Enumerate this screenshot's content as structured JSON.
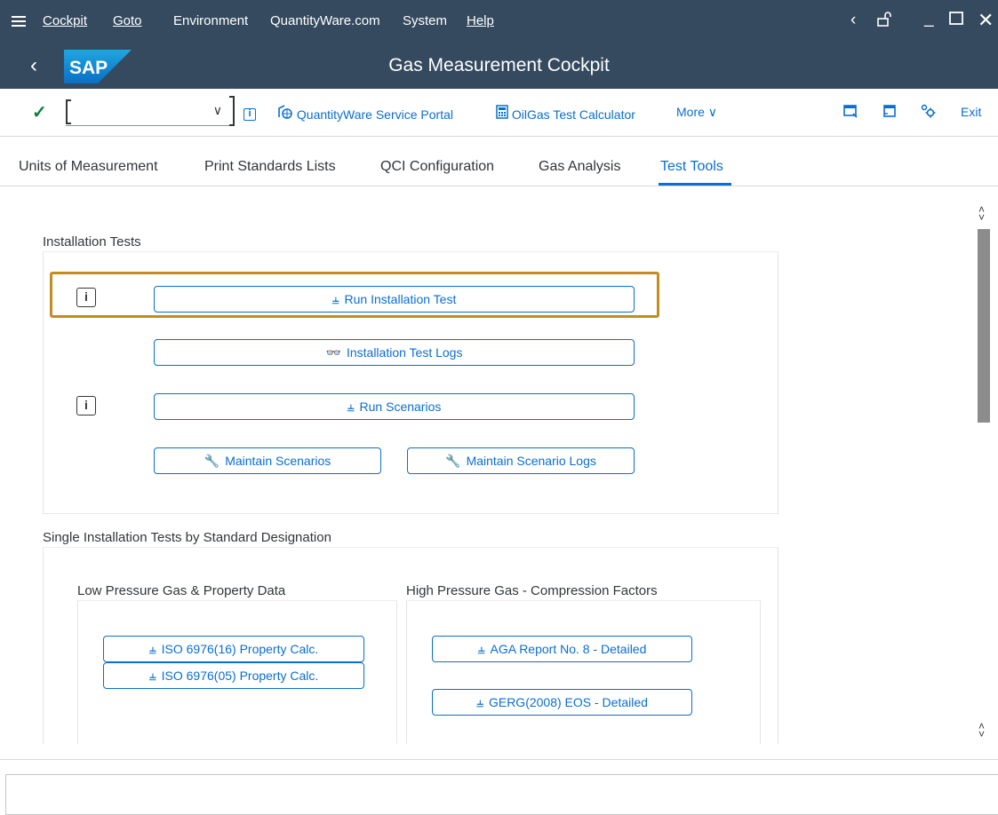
{
  "menubar": {
    "items": [
      "Cockpit",
      "Goto",
      "Environment",
      "QuantityWare.com",
      "System",
      "Help"
    ],
    "window_controls": {
      "back": "<",
      "lock": "lock-icon",
      "minimize": "_",
      "maximize": "□",
      "close": "×"
    }
  },
  "titlebar": {
    "logo": "SAP",
    "title": "Gas Measurement Cockpit"
  },
  "toolbar": {
    "command_field_value": "",
    "portal_label": "QuantityWare Service Portal",
    "calculator_label": "OilGas Test Calculator",
    "more_label": "More",
    "exit_label": "Exit",
    "colors": {
      "accent": "#0a6ed1",
      "check": "#107e3e",
      "shell": "#354a5f",
      "highlight": "#c28d1d"
    }
  },
  "tabs": [
    {
      "label": "Units of Measurement",
      "active": false
    },
    {
      "label": "Print Standards Lists",
      "active": false
    },
    {
      "label": "QCI Configuration",
      "active": false
    },
    {
      "label": "Gas Analysis",
      "active": false
    },
    {
      "label": "Test Tools",
      "active": true
    }
  ],
  "installation_tests": {
    "title": "Installation Tests",
    "run_installation_test": "Run Installation Test",
    "installation_test_logs": "Installation Test Logs",
    "run_scenarios": "Run Scenarios",
    "maintain_scenarios": "Maintain Scenarios",
    "maintain_scenario_logs": "Maintain Scenario Logs"
  },
  "single_tests": {
    "title": "Single Installation Tests by Standard Designation",
    "low_pressure": {
      "title": "Low Pressure Gas & Property Data",
      "buttons": [
        "ISO 6976(16) Property Calc.",
        "ISO 6976(05) Property Calc."
      ]
    },
    "high_pressure": {
      "title": "High Pressure Gas - Compression Factors",
      "buttons": [
        "AGA Report No. 8 - Detailed",
        "GERG(2008) EOS - Detailed"
      ]
    }
  },
  "status_bar": {
    "text": ""
  }
}
